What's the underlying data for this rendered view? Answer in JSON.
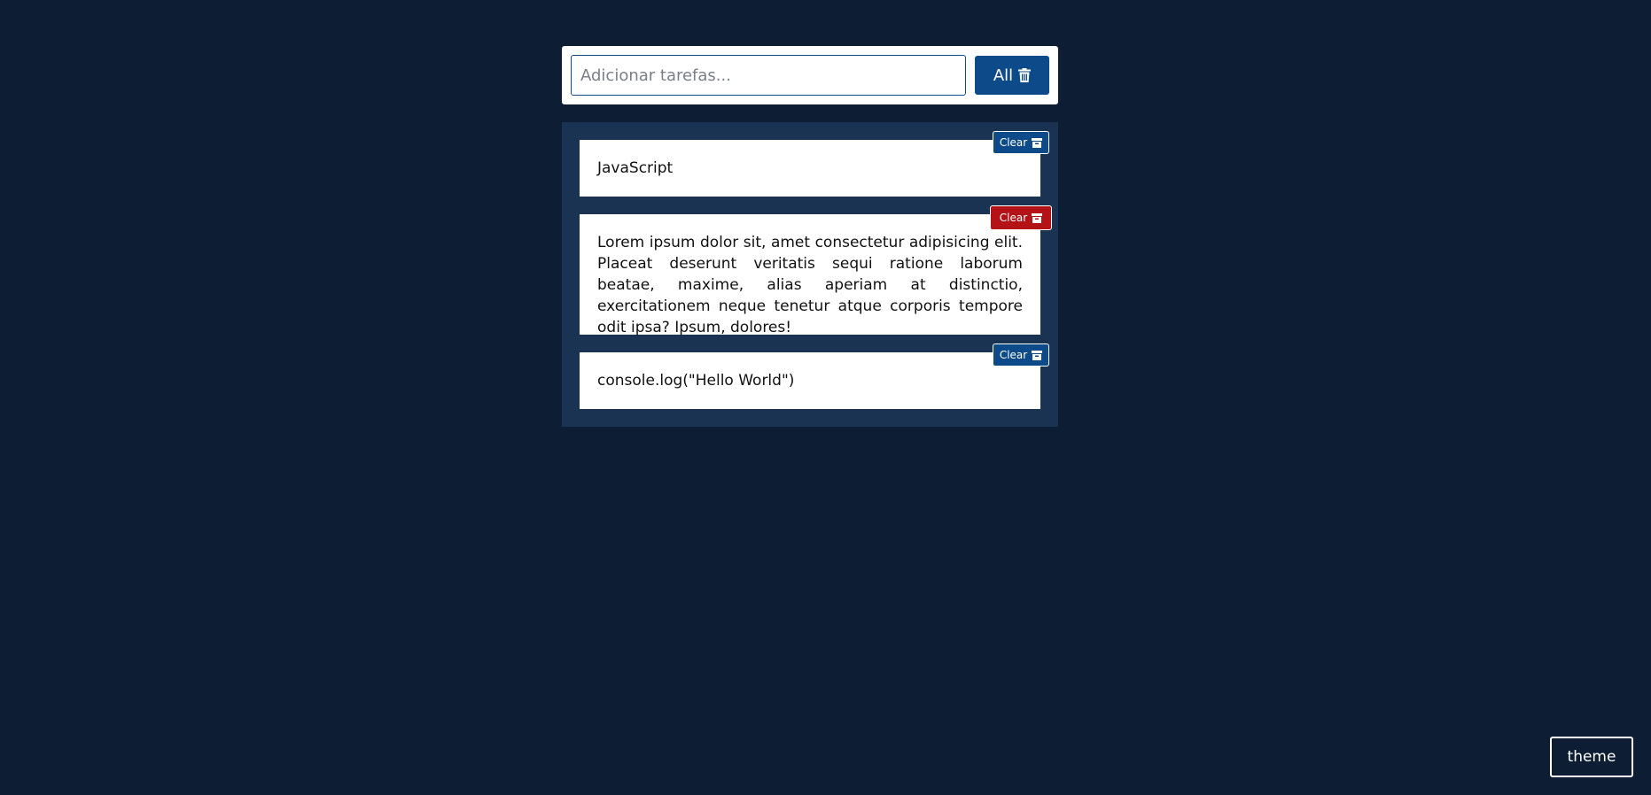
{
  "add_form": {
    "placeholder": "Adicionar tarefas...",
    "value": "",
    "clear_all_label": "All",
    "clear_all_icon": "trash-icon"
  },
  "tasks": [
    {
      "text": "JavaScript",
      "clear_label": "Clear",
      "clear_icon": "archive-icon",
      "state": "default"
    },
    {
      "text": "Lorem ipsum dolor sit, amet consectetur adipisicing elit. Placeat deserunt veritatis sequi ratione laborum beatae, maxime, alias aperiam at distinctio, exercitationem neque tenetur atque corporis tempore odit ipsa? Ipsum, dolores!",
      "clear_label": "Clear",
      "clear_icon": "archive-icon",
      "state": "hover"
    },
    {
      "text": "console.log(\"Hello World\")",
      "clear_label": "Clear",
      "clear_icon": "archive-icon",
      "state": "default"
    }
  ],
  "theme_toggle": {
    "label": "theme"
  },
  "colors": {
    "background": "#0d1d34",
    "panel": "#1a3352",
    "accent": "#0d4a8a",
    "danger": "#b31217"
  }
}
